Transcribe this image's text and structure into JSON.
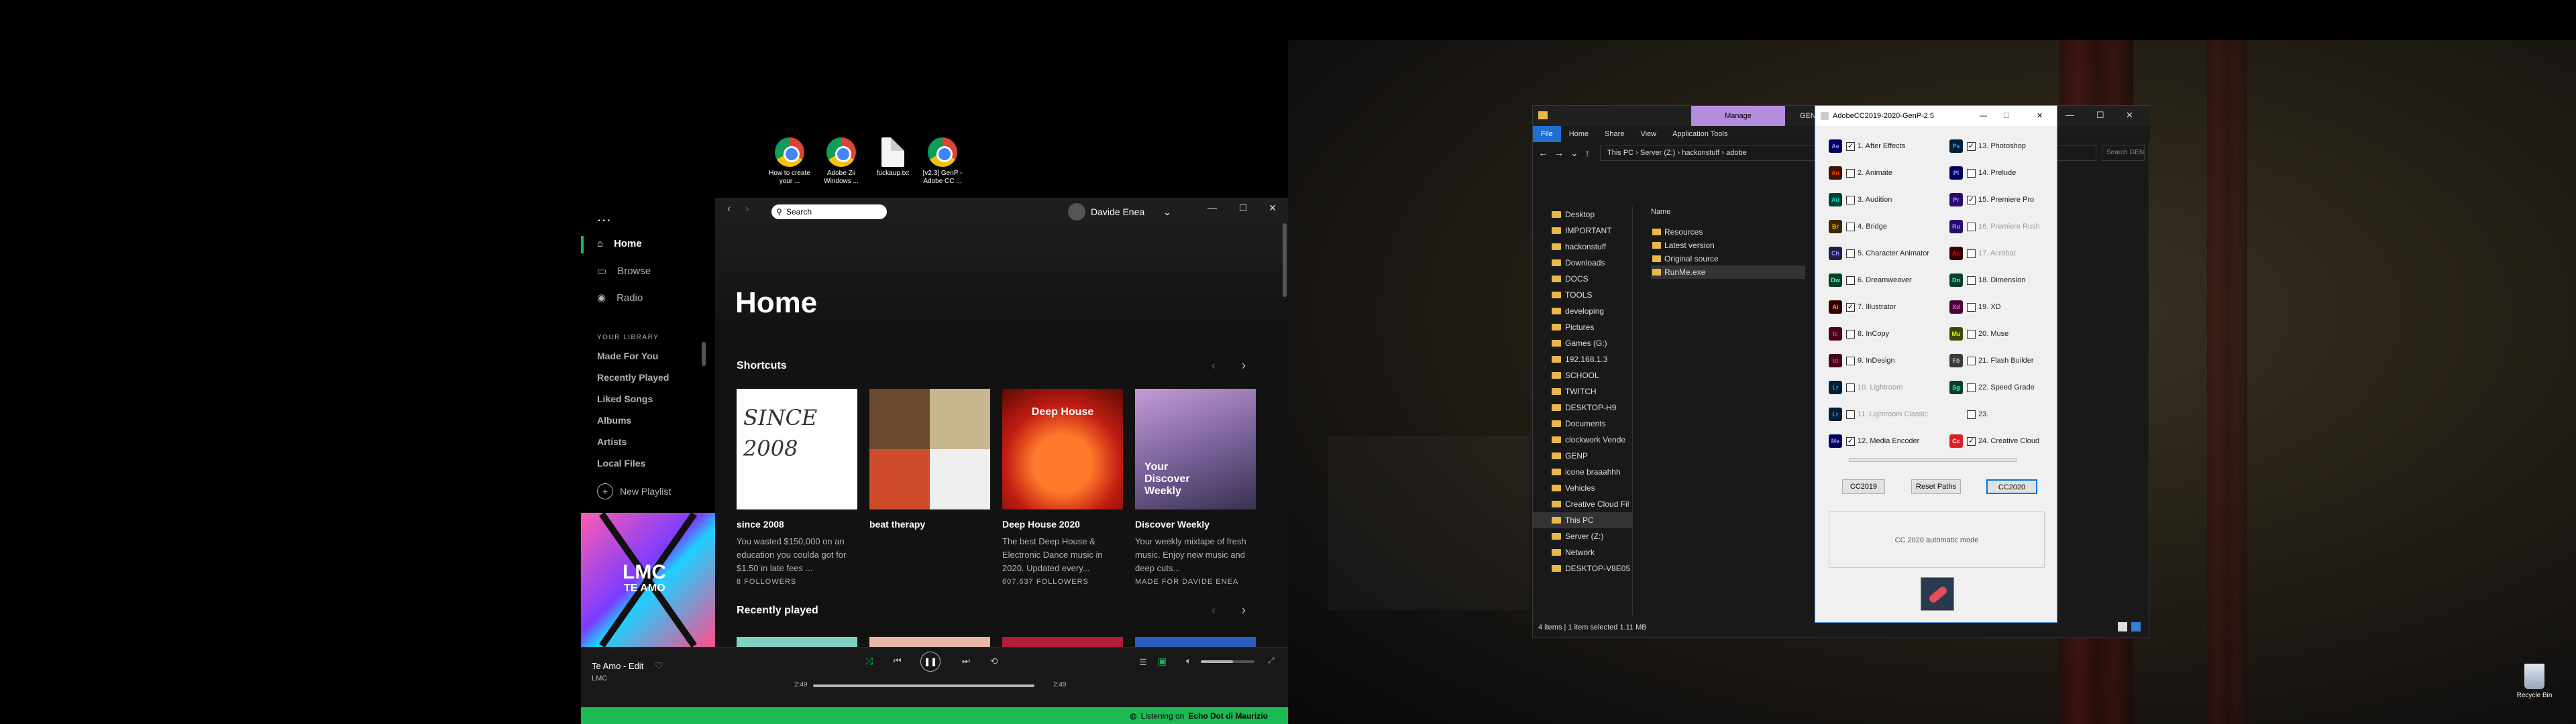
{
  "desktop": {
    "icons": [
      {
        "label": "How to create your ...",
        "type": "chrome"
      },
      {
        "label": "Adobe Zii Windows ...",
        "type": "chrome"
      },
      {
        "label": "fuckaup.txt",
        "type": "txt"
      },
      {
        "label": "[v2.3] GenP - Adobe CC ...",
        "type": "chrome"
      }
    ],
    "recycle_bin": "Recycle Bin"
  },
  "spotify": {
    "more": "...",
    "search_placeholder": "Search",
    "user": "Davide Enea",
    "nav": [
      "Home",
      "Browse",
      "Radio"
    ],
    "library_heading": "YOUR LIBRARY",
    "library": [
      "Made For You",
      "Recently Played",
      "Liked Songs",
      "Albums",
      "Artists",
      "Local Files"
    ],
    "new_playlist": "New Playlist",
    "cover_text": {
      "line1": "LMC",
      "line2": "TE AMO"
    },
    "page_title": "Home",
    "shortcuts": "Shortcuts",
    "cards": [
      {
        "title": "since 2008",
        "desc": "You wasted $150,000 on an education you coulda got for $1.50 in late fees ...",
        "footer": "8 FOLLOWERS",
        "art_text": "SINCE 2008"
      },
      {
        "title": "beat therapy",
        "desc": "",
        "footer": "",
        "art_text": ""
      },
      {
        "title": "Deep House 2020",
        "desc": "The best Deep House & Electronic Dance music in 2020. Updated every...",
        "footer": "607,637 FOLLOWERS",
        "art_text": "Deep House"
      },
      {
        "title": "Discover Weekly",
        "desc": "Your weekly mixtape of fresh music. Enjoy new music and deep cuts...",
        "footer": "MADE FOR DAVIDE ENEA",
        "art_text": "Your Discover Weekly"
      }
    ],
    "recently_played": "Recently played",
    "track": "Te Amo - Edit",
    "artist": "LMC",
    "time_elapsed": "2:49",
    "time_total": "2:49",
    "progress": 1.0,
    "volume": 0.6,
    "status_prefix": "Listening on",
    "status_device": "Echo Dot di Maurizio",
    "colors": {
      "green": "#1db954"
    }
  },
  "explorer": {
    "tabs": [
      "File",
      "Home",
      "Share",
      "View",
      "Application Tools"
    ],
    "manage": "Manage",
    "genp_tab": "GENP",
    "path": [
      "This PC",
      "Server (Z:)",
      "hackonstuff",
      "adobe"
    ],
    "search_placeholder": "Search GENP",
    "tree": [
      "Desktop",
      "IMPORTANT",
      "hackonstuff",
      "Downloads",
      "DOCS",
      "TOOLS",
      "developing",
      "Pictures",
      "Games (G:)",
      "192.168.1.3",
      "SCHOOL",
      "TWITCH",
      "DESKTOP-H9",
      "Documents",
      "clockwork Vende",
      "GENP",
      "icone braaahhh",
      "Vehicles",
      "Creative Cloud Fil",
      "This PC",
      "Server (Z:)",
      "Network",
      "DESKTOP-V8E05"
    ],
    "column_name": "Name",
    "files": [
      "Resources",
      "Latest version",
      "Original source",
      "RunMe.exe"
    ],
    "status": "4 items  |  1 item selected  1.11 MB"
  },
  "genp": {
    "title": "AdobeCC2019-2020-GenP-2.5",
    "apps": [
      {
        "label": "1. After Effects",
        "abbr": "Ae",
        "checked": true,
        "color": "#9999ff",
        "bg": "#00005b"
      },
      {
        "label": "2. Animate",
        "abbr": "An",
        "checked": false,
        "color": "#ff4c00",
        "bg": "#401000"
      },
      {
        "label": "3. Audition",
        "abbr": "Au",
        "checked": false,
        "color": "#00e4bb",
        "bg": "#00403a"
      },
      {
        "label": "4. Bridge",
        "abbr": "Br",
        "checked": false,
        "color": "#ffae00",
        "bg": "#3d2800"
      },
      {
        "label": "5. Character Animator",
        "abbr": "Ch",
        "checked": false,
        "color": "#9999ff",
        "bg": "#1f1f4a"
      },
      {
        "label": "6. Dreamweaver",
        "abbr": "Dw",
        "checked": false,
        "color": "#4affaa",
        "bg": "#06402a"
      },
      {
        "label": "7. Illustrator",
        "abbr": "Ai",
        "checked": true,
        "color": "#ff9a00",
        "bg": "#330000"
      },
      {
        "label": "8. InCopy",
        "abbr": "Ic",
        "checked": false,
        "color": "#ff33a0",
        "bg": "#49021f"
      },
      {
        "label": "9. InDesign",
        "abbr": "Id",
        "checked": false,
        "color": "#ff3366",
        "bg": "#49021f"
      },
      {
        "label": "10. Lightroom",
        "abbr": "Lr",
        "checked": false,
        "color": "#31a8ff",
        "bg": "#001e36"
      },
      {
        "label": "11. Lightroom Classic",
        "abbr": "Lr",
        "checked": false,
        "color": "#31a8ff",
        "bg": "#001e36"
      },
      {
        "label": "12. Media Encoder",
        "abbr": "Me",
        "checked": true,
        "color": "#9999ff",
        "bg": "#00005b"
      },
      {
        "label": "13. Photoshop",
        "abbr": "Ps",
        "checked": true,
        "color": "#31a8ff",
        "bg": "#001e36"
      },
      {
        "label": "14. Prelude",
        "abbr": "Pl",
        "checked": false,
        "color": "#9999ff",
        "bg": "#00005b"
      },
      {
        "label": "15. Premiere Pro",
        "abbr": "Pr",
        "checked": true,
        "color": "#9999ff",
        "bg": "#2a0a6a"
      },
      {
        "label": "16. Premiere Rush",
        "abbr": "Ru",
        "checked": false,
        "color": "#9999ff",
        "bg": "#2a0a6a"
      },
      {
        "label": "17. Acrobat",
        "abbr": "Ac",
        "checked": false,
        "color": "#ff0000",
        "bg": "#3a0000"
      },
      {
        "label": "18. Dimension",
        "abbr": "Dn",
        "checked": false,
        "color": "#4affaa",
        "bg": "#06402a"
      },
      {
        "label": "19. XD",
        "abbr": "Xd",
        "checked": false,
        "color": "#ff61f6",
        "bg": "#470137"
      },
      {
        "label": "20. Muse",
        "abbr": "Mu",
        "checked": false,
        "color": "#d4ff00",
        "bg": "#3a4a00"
      },
      {
        "label": "21. Flash Builder",
        "abbr": "Fb",
        "checked": false,
        "color": "#c8c8c8",
        "bg": "#3a3a3a"
      },
      {
        "label": "22. Speed Grade",
        "abbr": "Sg",
        "checked": false,
        "color": "#4affaa",
        "bg": "#06402a"
      },
      {
        "label": "23. ",
        "abbr": "",
        "checked": false,
        "color": "#000",
        "bg": "#f0f0f0"
      },
      {
        "label": "24. Creative Cloud",
        "abbr": "Cc",
        "checked": true,
        "color": "#fff",
        "bg": "#da1f26"
      }
    ],
    "btn_cc2019": "CC2019",
    "btn_reset": "Reset Paths",
    "btn_cc2020": "CC2020",
    "mode_text": "CC 2020 automatic mode"
  }
}
